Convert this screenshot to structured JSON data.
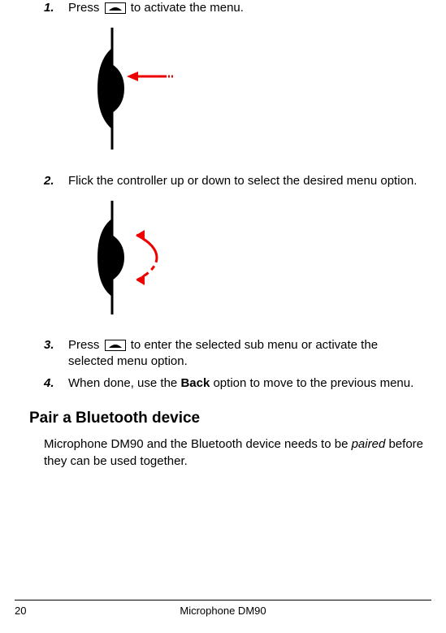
{
  "steps": {
    "s1": {
      "num": "1.",
      "pre": "Press ",
      "post": " to activate the menu."
    },
    "s2": {
      "num": "2.",
      "text": "Flick the controller up or down to select the desired menu option."
    },
    "s3": {
      "num": "3.",
      "pre": "Press ",
      "post": " to enter the selected sub menu or activate the selected menu option."
    },
    "s4": {
      "num": "4.",
      "pre": "When done, use the ",
      "bold": "Back",
      "post": " option to move to the previous menu."
    }
  },
  "section": {
    "heading": "Pair a Bluetooth device",
    "para_pre": "Microphone DM90 and the Bluetooth device needs to be ",
    "para_em": "paired",
    "para_post": " before they can be used together."
  },
  "footer": {
    "page": "20",
    "title": "Microphone DM90"
  }
}
